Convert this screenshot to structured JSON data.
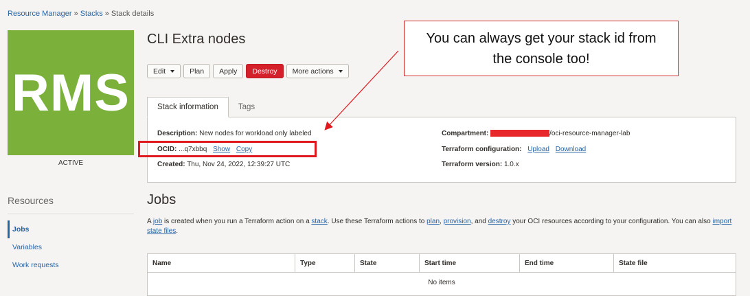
{
  "breadcrumb": {
    "items": [
      "Resource Manager",
      "Stacks",
      "Stack details"
    ],
    "sep": "»"
  },
  "logo_text": "RMS",
  "status": "ACTIVE",
  "resources": {
    "title": "Resources",
    "items": [
      "Jobs",
      "Variables",
      "Work requests"
    ]
  },
  "page_title": "CLI Extra nodes",
  "toolbar": {
    "edit": "Edit",
    "plan": "Plan",
    "apply": "Apply",
    "destroy": "Destroy",
    "more": "More actions"
  },
  "tabs": [
    "Stack information",
    "Tags"
  ],
  "info": {
    "description_label": "Description:",
    "description_value": "New nodes for workload only labeled",
    "ocid_label": "OCID:",
    "ocid_value": "...q7xbbq",
    "ocid_show": "Show",
    "ocid_copy": "Copy",
    "created_label": "Created:",
    "created_value": "Thu, Nov 24, 2022, 12:39:27 UTC",
    "compartment_label": "Compartment:",
    "compartment_value": "/oci-resource-manager-lab",
    "terraform_config_label": "Terraform configuration:",
    "upload": "Upload",
    "download": "Download",
    "terraform_version_label": "Terraform version:",
    "terraform_version_value": "1.0.x"
  },
  "callout": {
    "text": "You can always get your stack id from the console too!"
  },
  "jobs": {
    "title": "Jobs",
    "desc_parts": [
      "A ",
      "job",
      " is created when you run a Terraform action on a ",
      "stack",
      ". Use these Terraform actions to ",
      "plan",
      ", ",
      "provision",
      ", and ",
      "destroy",
      " your OCI resources according to your configuration. You can also ",
      "import state files",
      "."
    ],
    "columns": [
      "Name",
      "Type",
      "State",
      "Start time",
      "End time",
      "State file"
    ],
    "empty": "No items"
  },
  "colors": {
    "accent": "#2764a6",
    "danger": "#d3202a",
    "logo_bg": "#7bb03b",
    "annotation": "#e0191f"
  }
}
